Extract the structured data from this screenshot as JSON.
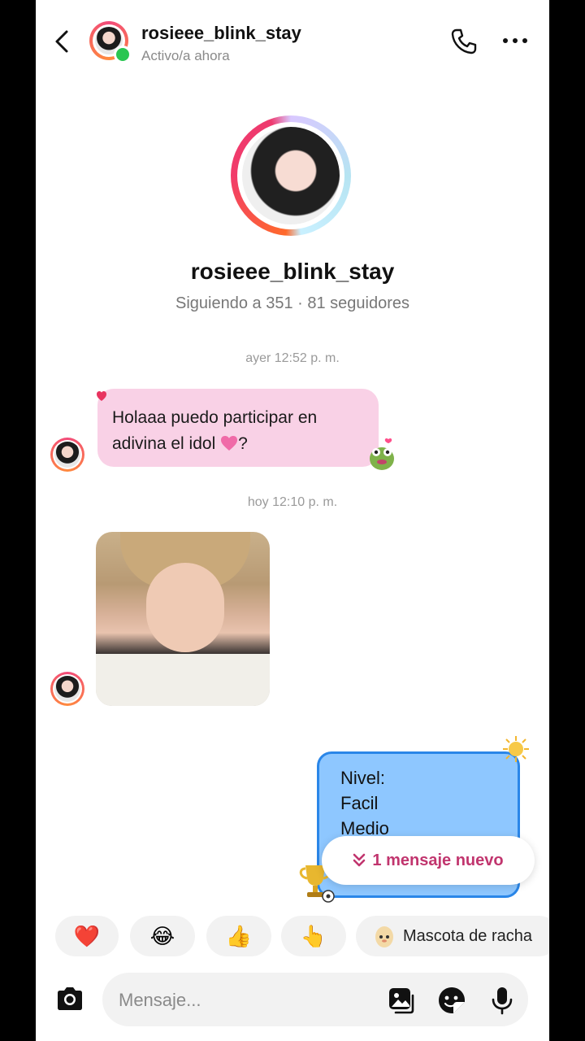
{
  "header": {
    "username": "rosieee_blink_stay",
    "status": "Activo/a ahora"
  },
  "profile": {
    "username": "rosieee_blink_stay",
    "stats": "Siguiendo a 351 · 81 seguidores"
  },
  "timestamps": {
    "first": "ayer 12:52 p. m.",
    "second": "hoy 12:10 p. m."
  },
  "messages": {
    "incoming_text_line1": "Holaaa puedo participar en",
    "incoming_text_line2_prefix": "adivina el idol ",
    "incoming_text_line2_suffix": "?",
    "outgoing_lines": [
      "Nivel:",
      "Facil",
      "Medio"
    ]
  },
  "new_messages_pill": {
    "icon": "double-chevron-down",
    "label": "1 mensaje nuevo"
  },
  "quick_reactions": {
    "heart": "❤️",
    "laugh": "😂",
    "thumbs": "👍",
    "point": "👆",
    "streak_label": "Mascota de racha"
  },
  "composer": {
    "placeholder": "Mensaje..."
  },
  "colors": {
    "incoming_bubble": "#f9d1e6",
    "outgoing_bubble": "#8ec7ff",
    "outgoing_border": "#2a86e8",
    "online": "#29c651",
    "pill_text": "#c1356e"
  }
}
